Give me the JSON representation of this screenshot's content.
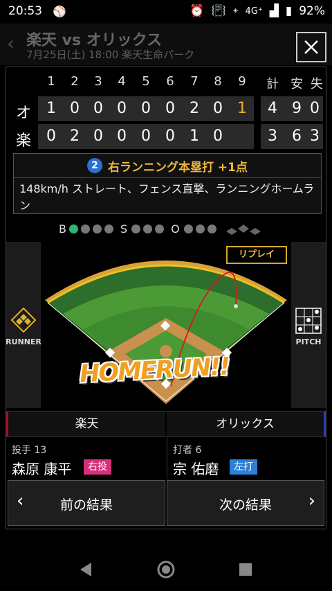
{
  "status": {
    "time": "20:53",
    "network": "4G⁺",
    "battery": "92%"
  },
  "background": {
    "title": "楽天 vs オリックス",
    "subtitle": "7月25日(土) 18:00 楽天生命パーク"
  },
  "scoreboard": {
    "innings": [
      "1",
      "2",
      "3",
      "4",
      "5",
      "6",
      "7",
      "8",
      "9"
    ],
    "total_headers": [
      "計",
      "安",
      "失"
    ],
    "teams": [
      {
        "abbr": "オ",
        "innings": [
          "1",
          "0",
          "0",
          "0",
          "0",
          "0",
          "2",
          "0",
          "1"
        ],
        "totals": [
          "4",
          "9",
          "0"
        ]
      },
      {
        "abbr": "楽",
        "innings": [
          "0",
          "2",
          "0",
          "0",
          "0",
          "0",
          "1",
          "0",
          ""
        ],
        "totals": [
          "3",
          "6",
          "3"
        ]
      }
    ]
  },
  "play": {
    "number": "2",
    "title": "右ランニング本塁打 +1点",
    "description": "148km/h ストレート、フェンス直撃、ランニングホームラン"
  },
  "count": {
    "b_label": "B",
    "s_label": "S",
    "o_label": "O",
    "balls": 1,
    "strikes": 0,
    "outs": 0
  },
  "field": {
    "replay_label": "リプレイ",
    "banner": "HOMERUN!!",
    "runner_label": "RUNNER",
    "pitch_label": "PITCH"
  },
  "teams": {
    "home": "楽天",
    "away": "オリックス"
  },
  "pitcher": {
    "role": "投手 13",
    "name": "森原 康平",
    "hand": "右投"
  },
  "batter": {
    "role": "打者 6",
    "name": "宗 佑磨",
    "hand": "左打"
  },
  "nav": {
    "prev": "前の結果",
    "next": "次の結果"
  },
  "colors": {
    "accent": "#f0b83a",
    "home": "#a0102a",
    "away": "#2a3fb0",
    "ball": "#2bb673"
  }
}
